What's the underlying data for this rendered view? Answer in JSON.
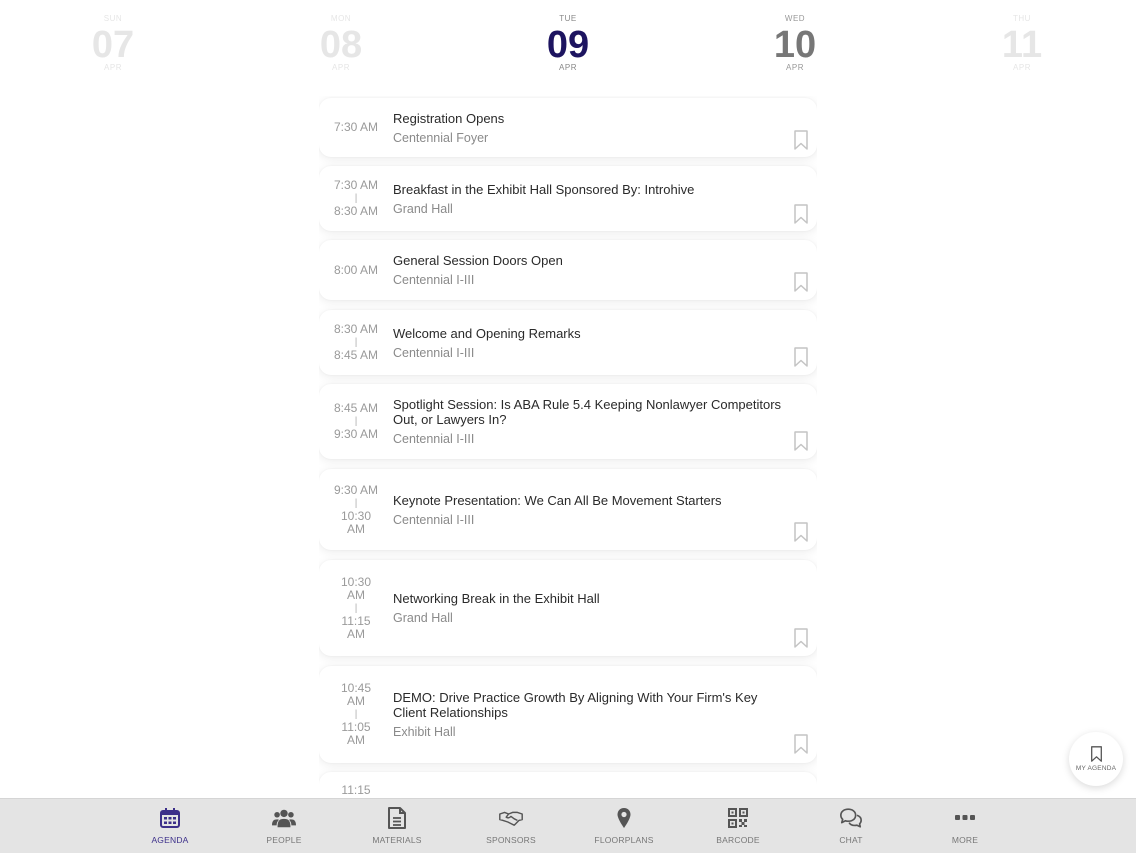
{
  "dates": [
    {
      "dow": "Sun",
      "day": "07",
      "month": "Apr"
    },
    {
      "dow": "Mon",
      "day": "08",
      "month": "Apr"
    },
    {
      "dow": "Tue",
      "day": "09",
      "month": "Apr"
    },
    {
      "dow": "Wed",
      "day": "10",
      "month": "Apr"
    },
    {
      "dow": "Thu",
      "day": "11",
      "month": "Apr"
    }
  ],
  "sessions": [
    {
      "start": "7:30 AM",
      "end": "",
      "title": "Registration Opens",
      "location": "Centennial Foyer"
    },
    {
      "start": "7:30 AM",
      "end": "8:30 AM",
      "title": "Breakfast in the Exhibit Hall Sponsored By: Introhive",
      "location": "Grand Hall"
    },
    {
      "start": "8:00 AM",
      "end": "",
      "title": "General Session Doors Open",
      "location": "Centennial I-III"
    },
    {
      "start": "8:30 AM",
      "end": "8:45 AM",
      "title": "Welcome and Opening Remarks",
      "location": "Centennial I-III"
    },
    {
      "start": "8:45 AM",
      "end": "9:30 AM",
      "title": "Spotlight Session: Is ABA Rule 5.4 Keeping Nonlawyer Competitors Out, or Lawyers In?",
      "location": "Centennial I-III"
    },
    {
      "start": "9:30 AM",
      "end": "10:30 AM",
      "title": "Keynote Presentation: We Can All Be Movement Starters",
      "location": "Centennial I-III"
    },
    {
      "start": "10:30 AM",
      "end": "11:15 AM",
      "title": "Networking Break in the Exhibit Hall",
      "location": "Grand Hall"
    },
    {
      "start": "10:45 AM",
      "end": "11:05 AM",
      "title": "DEMO: Drive Practice Growth By Aligning With Your Firm's Key Client Relationships",
      "location": "Exhibit Hall"
    },
    {
      "start": "11:15",
      "end": "",
      "title": "",
      "location": ""
    }
  ],
  "separator": "|",
  "my_agenda_label": "MY AGENDA",
  "tabs": [
    {
      "label": "AGENDA",
      "icon": "calendar-icon"
    },
    {
      "label": "PEOPLE",
      "icon": "people-icon"
    },
    {
      "label": "MATERIALS",
      "icon": "document-icon"
    },
    {
      "label": "SPONSORS",
      "icon": "handshake-icon"
    },
    {
      "label": "FLOORPLANS",
      "icon": "map-pin-icon"
    },
    {
      "label": "BARCODE",
      "icon": "qr-code-icon"
    },
    {
      "label": "CHAT",
      "icon": "chat-icon"
    },
    {
      "label": "MORE",
      "icon": "more-icon"
    }
  ],
  "colors": {
    "accent": "#1d1460",
    "active_tab": "#3c2f8a",
    "tabbar_bg": "#e4e4e4"
  }
}
